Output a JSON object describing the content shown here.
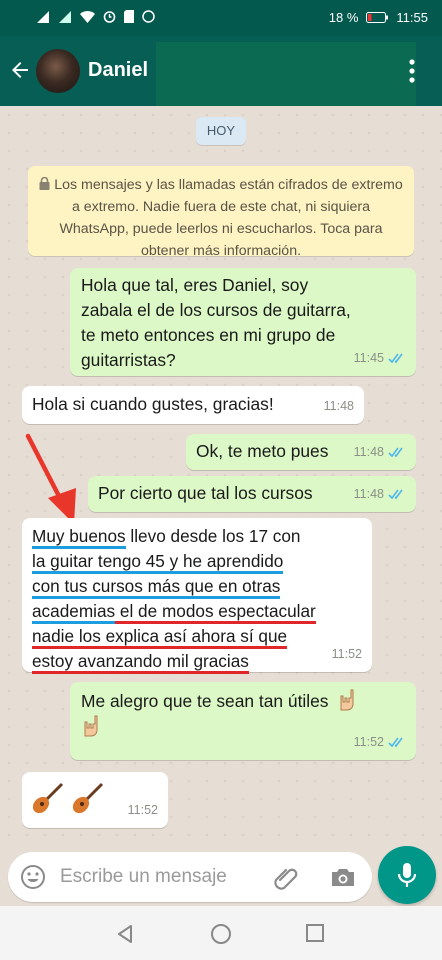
{
  "status": {
    "battery": "18 %",
    "time": "11:55"
  },
  "header": {
    "contact_name": "Daniel"
  },
  "chat": {
    "date_chip": "HOY",
    "encryption_notice": "Los mensajes y las llamadas están cifrados de extremo a extremo. Nadie fuera de este chat, ni siquiera WhatsApp, puede leerlos ni escucharlos. Toca para obtener más información.",
    "messages": [
      {
        "lines": [
          "Hola que tal, eres Daniel, soy",
          "zabala el de los cursos de guitarra,",
          "te meto entonces en mi grupo de",
          "guitarristas?"
        ],
        "time": "11:45"
      },
      {
        "text": "Hola si cuando gustes, gracias!",
        "time": "11:48"
      },
      {
        "text": "Ok, te meto pues",
        "time": "11:48"
      },
      {
        "text": "Por cierto que tal los cursos",
        "time": "11:48"
      },
      {
        "parts": [
          "Muy buenos",
          " llevo desde los 17 con",
          "la guitar tengo 45 y ",
          "he aprendido",
          "con tus cursos más que en otras",
          "academias",
          " el de modos espectacular",
          "nadie los explica así ahora sí que",
          "estoy avanzando mil gracias"
        ],
        "time": "11:52"
      },
      {
        "text": "Me alegro que te sean tan útiles",
        "time": "11:52"
      },
      {
        "text": "",
        "time": "11:52"
      }
    ]
  },
  "input": {
    "placeholder": "Escribe un mensaje"
  },
  "colors": {
    "header": "#075e54",
    "outgoing": "#dcf8c6",
    "incoming": "#ffffff",
    "accent": "#009688",
    "highlight_blue": "#1e9ce0",
    "highlight_red": "#e0262b"
  },
  "icons": [
    "back-arrow-icon",
    "menu-dots-icon",
    "lock-icon",
    "double-check-icon",
    "rock-hand-emoji-icon",
    "guitar-emoji-icon",
    "emoji-icon",
    "attach-icon",
    "camera-icon",
    "mic-icon",
    "nav-back-icon",
    "nav-home-icon",
    "nav-recents-icon"
  ]
}
